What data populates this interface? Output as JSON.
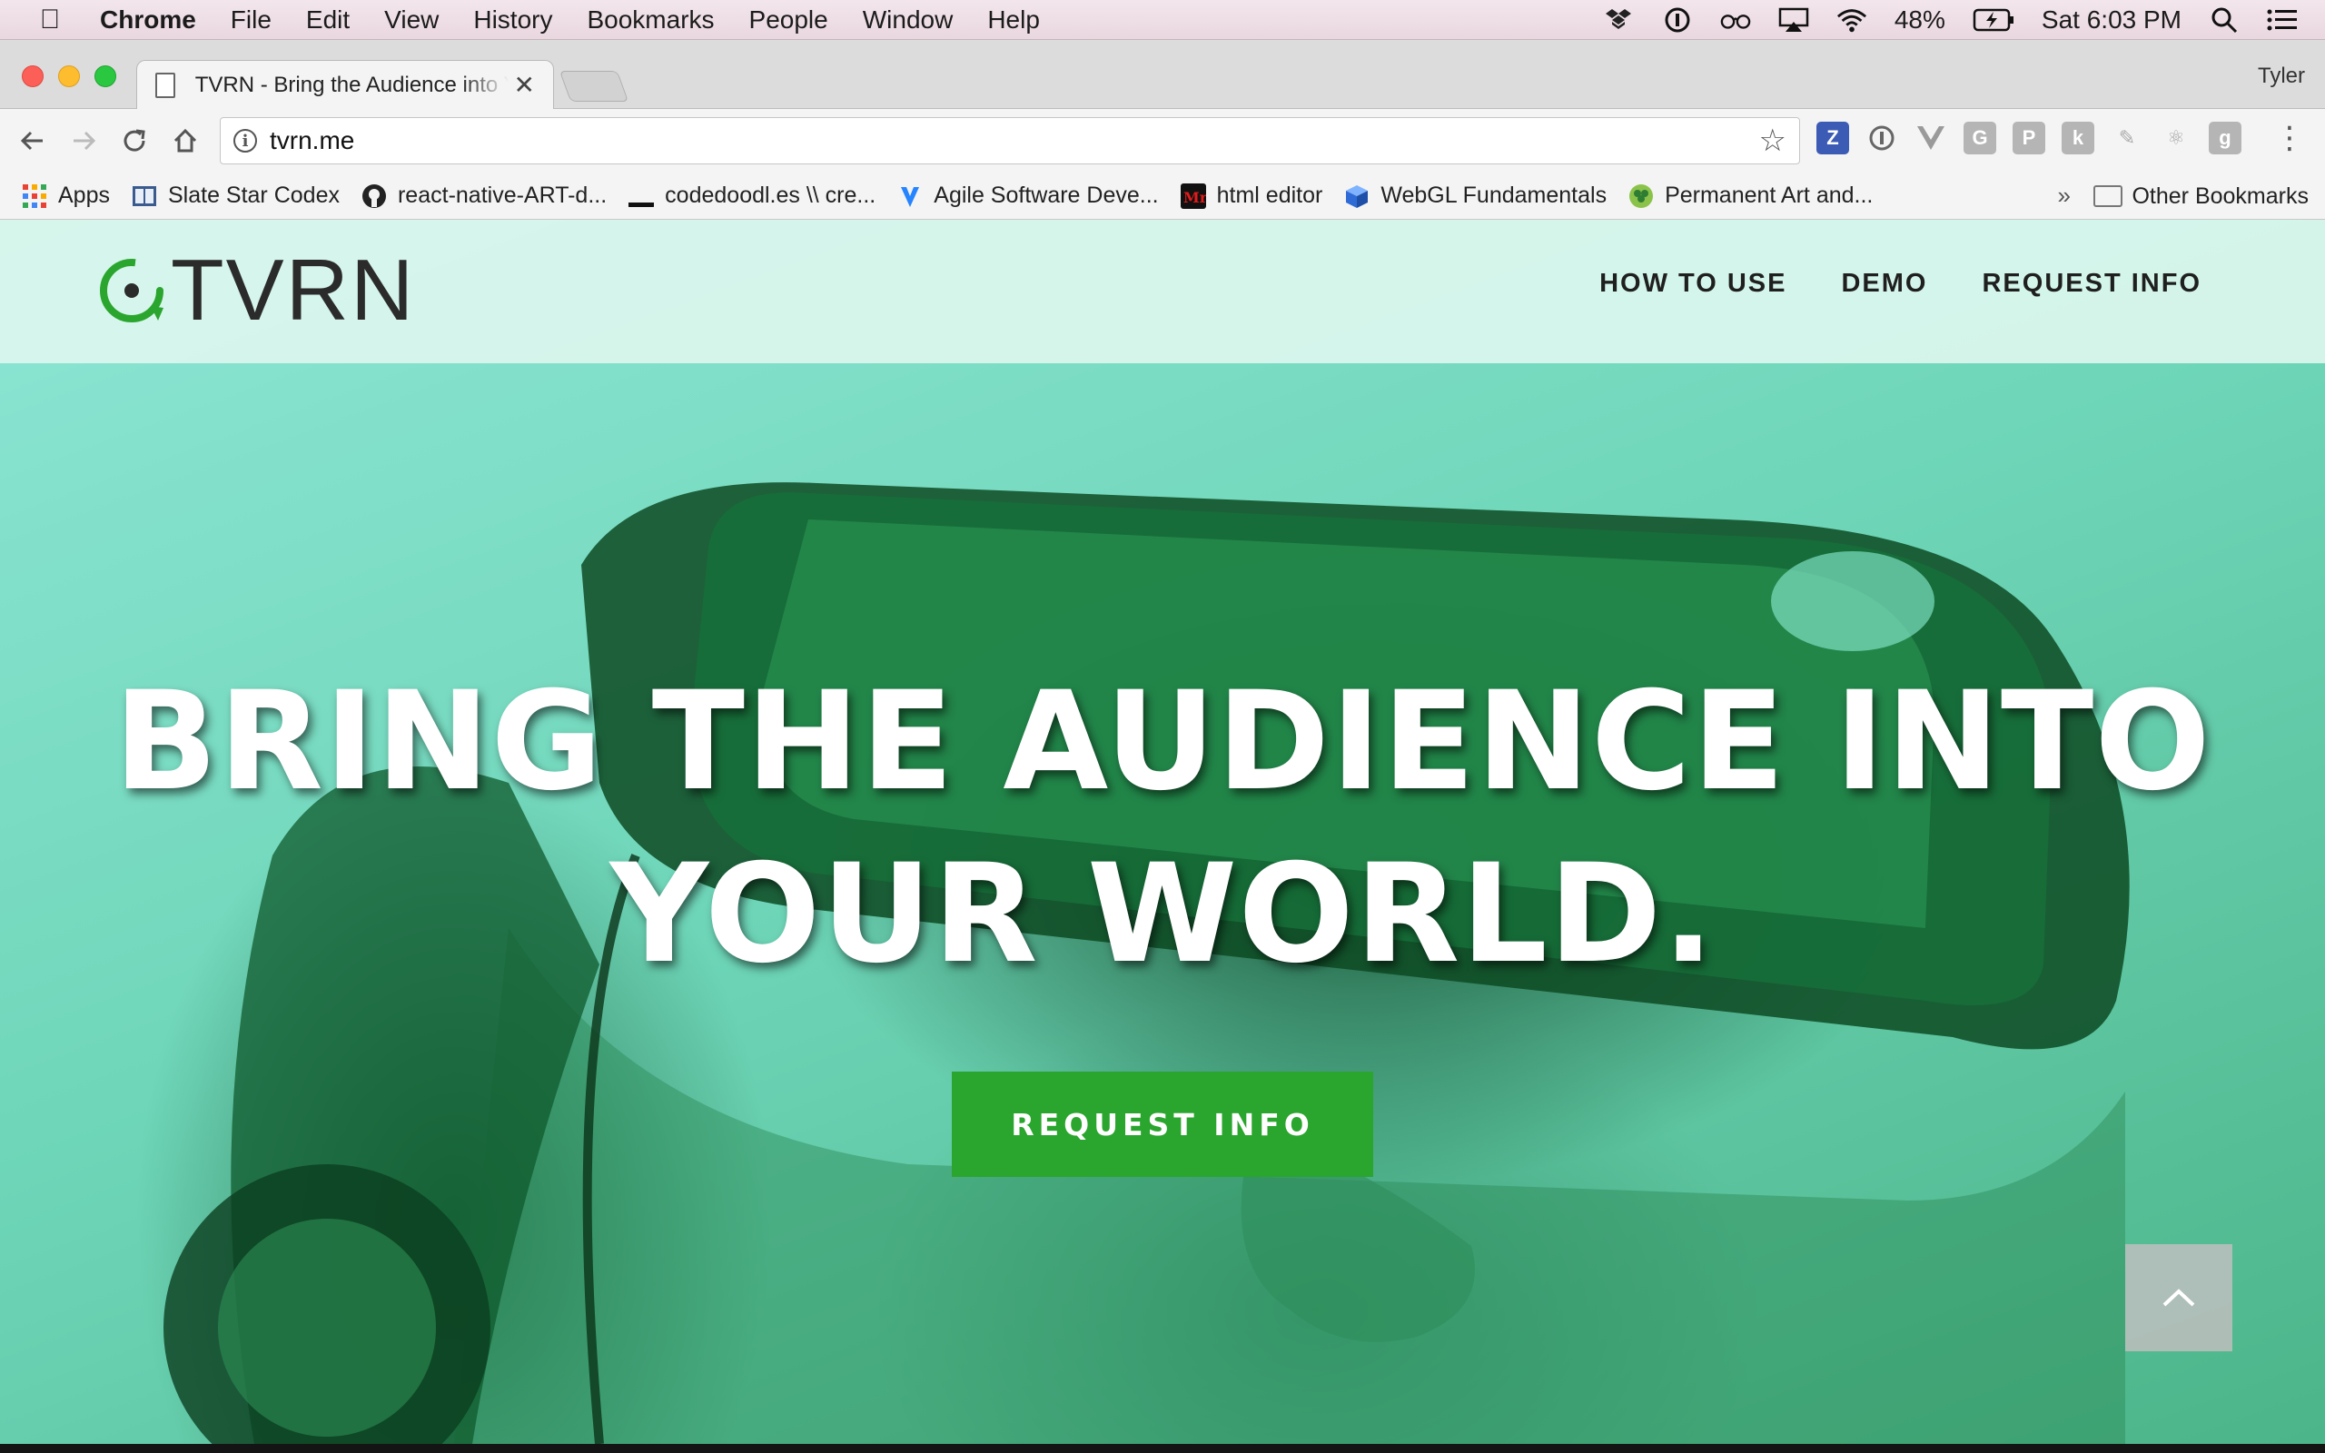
{
  "os_menubar": {
    "app_name": "Chrome",
    "menus": [
      "File",
      "Edit",
      "View",
      "History",
      "Bookmarks",
      "People",
      "Window",
      "Help"
    ],
    "battery": "48%",
    "clock": "Sat 6:03 PM"
  },
  "browser": {
    "tab": {
      "title": "TVRN - Bring the Audience into Your World"
    },
    "profile_name": "Tyler",
    "address": "tvrn.me",
    "extensions": [
      {
        "label": "Z",
        "color": "#3b5bb5"
      },
      {
        "label": "ⓘ",
        "color": "#ffffff"
      },
      {
        "label": "V",
        "color": "#9a9a9a"
      },
      {
        "label": "G",
        "color": "#b5b5b5"
      },
      {
        "label": "P",
        "color": "#b5b5b5"
      },
      {
        "label": "k",
        "color": "#b5b5b5"
      },
      {
        "label": "✎",
        "color": "#c8c8c8"
      },
      {
        "label": "⚛",
        "color": "#c8c8c8"
      },
      {
        "label": "g",
        "color": "#b5b5b5"
      }
    ],
    "bookmarks": [
      {
        "label": "Apps",
        "icon": "apps-grid-icon"
      },
      {
        "label": "Slate Star Codex",
        "icon": "book-icon"
      },
      {
        "label": "react-native-ART-d...",
        "icon": "github-icon"
      },
      {
        "label": "codedoodl.es \\\\ cre...",
        "icon": "underscore-icon"
      },
      {
        "label": "Agile Software Deve...",
        "icon": "atlassian-icon"
      },
      {
        "label": "html editor",
        "icon": "mr-icon"
      },
      {
        "label": "WebGL Fundamentals",
        "icon": "cube-icon"
      },
      {
        "label": "Permanent Art and...",
        "icon": "shamrock-icon"
      }
    ],
    "bookmarks_overflow": "»",
    "other_bookmarks": "Other Bookmarks"
  },
  "site": {
    "logo_text": "TVRN",
    "nav": [
      "HOW TO USE",
      "DEMO",
      "REQUEST INFO"
    ],
    "headline_line1": "BRING THE AUDIENCE INTO",
    "headline_line2": "YOUR WORLD.",
    "cta_label": "REQUEST INFO"
  },
  "colors": {
    "brand_green": "#2aa52e",
    "hero_teal": "#6fd6b9",
    "header_bg": "#dcf6ee"
  }
}
